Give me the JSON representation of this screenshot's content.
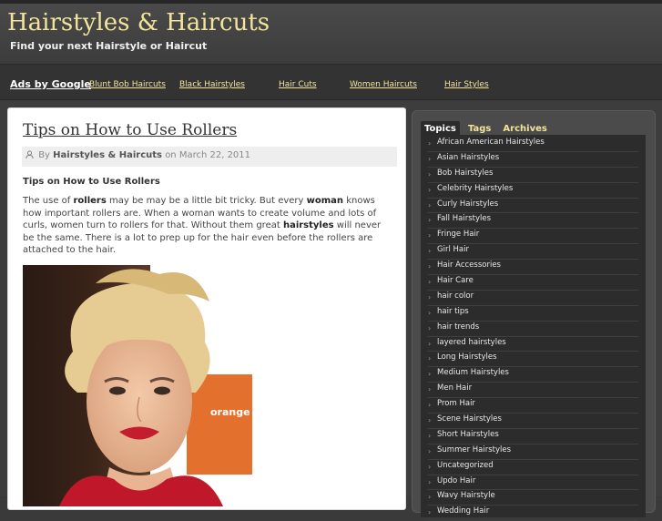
{
  "header": {
    "site_title": "Hairstyles & Haircuts",
    "tagline": "Find your next Hairstyle or Haircut"
  },
  "adbar": {
    "label": "Ads by Google",
    "links": [
      "Blunt Bob Haircuts",
      "Black Hairstyles",
      "Hair Cuts",
      "Women Haircuts",
      "Hair Styles"
    ]
  },
  "post": {
    "title": "Tips on How to Use Rollers",
    "meta_by": "By",
    "meta_author": "Hairstyles & Haircuts",
    "meta_on": "on March 22, 2011",
    "subheading": "Tips on How to Use Rollers",
    "paragraph": {
      "t1": "The use of ",
      "b1": "rollers",
      "t2": " may be may be a little bit tricky. But every ",
      "b2": "woman",
      "t3": " knows how important rollers are. When a woman wants to create volume and lots of curls, women turn to rollers for that. Without them great ",
      "b3": "hairstyles",
      "t4": " will never be the same. There is a lot to prep up for the hair even before the rollers are attached to the hair."
    },
    "image_text": "orange"
  },
  "sidebar": {
    "tabs": [
      "Topics",
      "Tags",
      "Archives"
    ],
    "topics": [
      "African American Hairstyles",
      "Asian Hairstyles",
      "Bob Hairstyles",
      "Celebrity Hairstyles",
      "Curly Hairstyles",
      "Fall Hairstyles",
      "Fringe Hair",
      "Girl Hair",
      "Hair Accessories",
      "Hair Care",
      "hair color",
      "hair tips",
      "hair trends",
      "layered hairstyles",
      "Long Hairstyles",
      "Medium Hairstyles",
      "Men Hair",
      "Prom Hair",
      "Scene Hairstyles",
      "Short Hairstyles",
      "Summer Hairstyles",
      "Uncategorized",
      "Updo Hair",
      "Wavy Hairstyle",
      "Wedding Hair"
    ]
  },
  "colors": {
    "accent": "#f2e59a",
    "background": "#3a3a3a"
  }
}
